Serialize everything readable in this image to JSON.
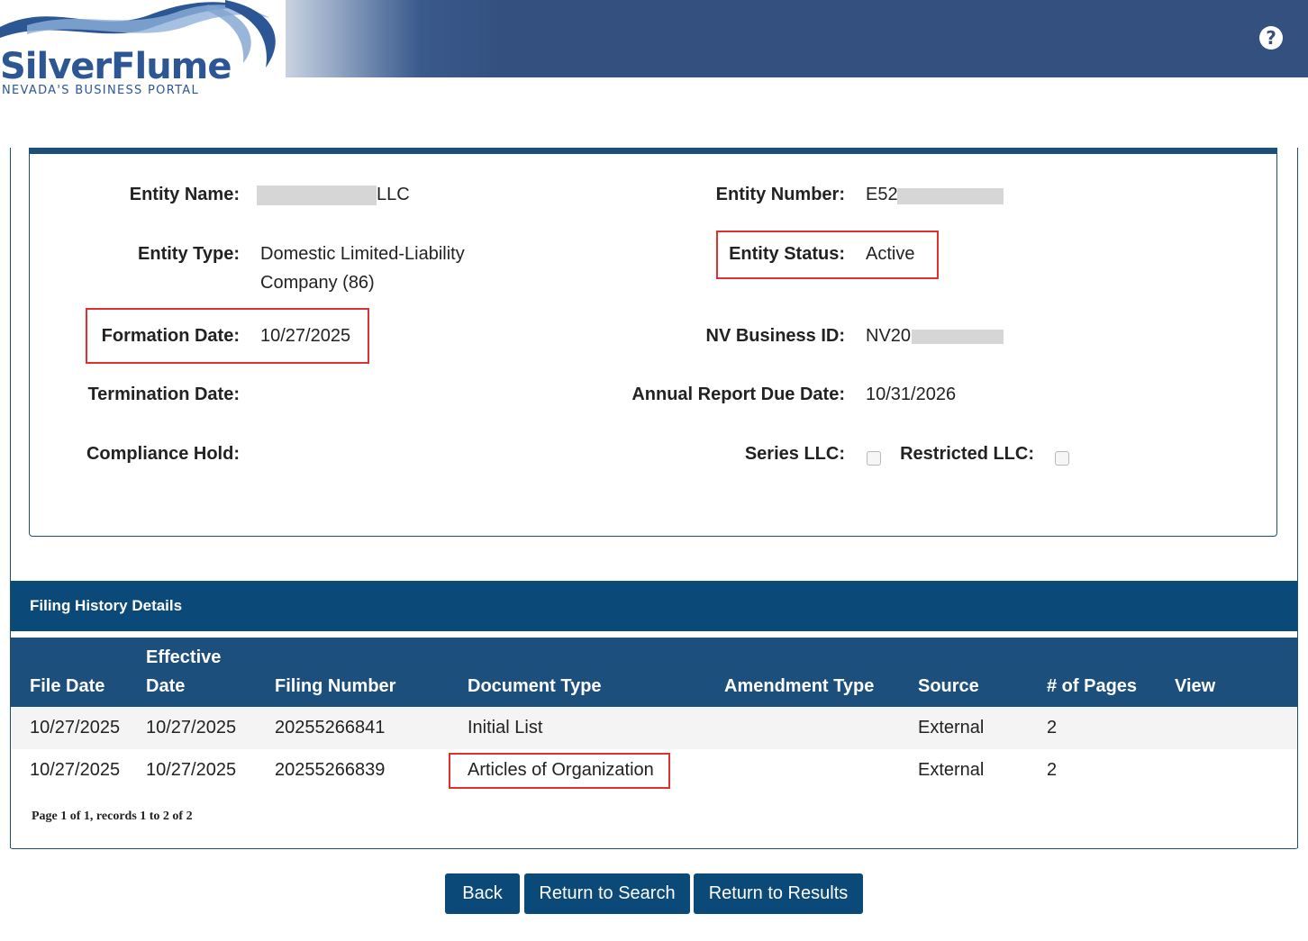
{
  "header": {
    "logo_text": "SilverFlume",
    "logo_subtitle": "NEVADA'S BUSINESS PORTAL",
    "help_icon": "question-circle-icon",
    "help_glyph": "?",
    "colors": {
      "bar": "#33507f",
      "logo": "#2c5694"
    }
  },
  "entity": {
    "name_label": "Entity Name:",
    "name_suffix": "LLC",
    "number_label": "Entity Number:",
    "number_value": "E52",
    "type_label": "Entity Type:",
    "type_value_line1": "Domestic Limited-Liability",
    "type_value_line2": "Company (86)",
    "status_label": "Entity Status:",
    "status_value": "Active",
    "formation_label": "Formation Date:",
    "formation_value": "10/27/2025",
    "nvid_label": "NV Business ID:",
    "nvid_value": "NV20",
    "termination_label": "Termination Date:",
    "termination_value": "",
    "annual_label": "Annual Report Due Date:",
    "annual_value": "10/31/2026",
    "compliance_label": "Compliance Hold:",
    "compliance_value": "",
    "series_label": "Series LLC:",
    "series_checked": false,
    "restricted_label": "Restricted LLC:",
    "restricted_checked": false
  },
  "filing_history": {
    "title": "Filing History Details",
    "columns": {
      "file_date": "File Date",
      "effective_line1": "Effective",
      "effective_line2": "Date",
      "filing_number": "Filing Number",
      "document_type": "Document Type",
      "amendment_type": "Amendment Type",
      "source": "Source",
      "pages": "# of Pages",
      "view": "View"
    },
    "rows": [
      {
        "file_date": "10/27/2025",
        "effective_date": "10/27/2025",
        "filing_number": "20255266841",
        "document_type": "Initial List",
        "amendment_type": "",
        "source": "External",
        "pages": "2"
      },
      {
        "file_date": "10/27/2025",
        "effective_date": "10/27/2025",
        "filing_number": "20255266839",
        "document_type": "Articles of Organization",
        "amendment_type": "",
        "source": "External",
        "pages": "2"
      }
    ],
    "pager": "Page 1 of 1, records 1 to 2 of 2"
  },
  "buttons": {
    "back": "Back",
    "return_search": "Return to Search",
    "return_results": "Return to Results"
  },
  "highlight_color": "#e03030"
}
